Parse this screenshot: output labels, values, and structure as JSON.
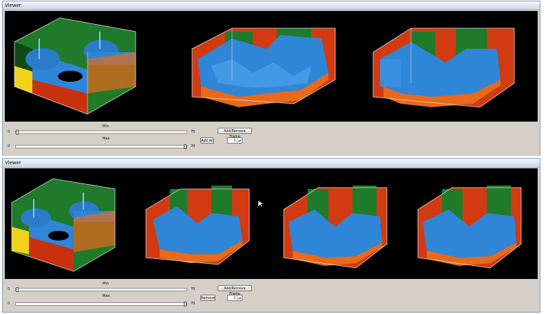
{
  "viewer1": {
    "title": "Viewer",
    "min_label": "Min",
    "max_label": "Max",
    "min_left": "0",
    "min_right": "70",
    "max_left": "0",
    "max_right": "70",
    "add_remove_label": "Add/Remove Frame",
    "add_all_label": "Add All",
    "frame_value": "1",
    "min_level": 0.0,
    "max_level": 1.0
  },
  "viewer2": {
    "title": "Viewer",
    "min_label": "Min",
    "max_label": "Max",
    "min_left": "0",
    "min_right": "70",
    "max_left": "0",
    "max_right": "70",
    "add_remove_label": "Add/Remove Frame",
    "remove_label": "Remove",
    "frame_value": "1",
    "min_level": 0.0,
    "max_level": 1.0
  },
  "colors": {
    "background": "#000000",
    "surface_blue": "#2f86d6",
    "wall_green": "#1f7a2a",
    "wall_red": "#d23a12",
    "wall_orange": "#e86a1a",
    "edge_yellow": "#f2d21a",
    "panel": "#d4d0c8"
  }
}
